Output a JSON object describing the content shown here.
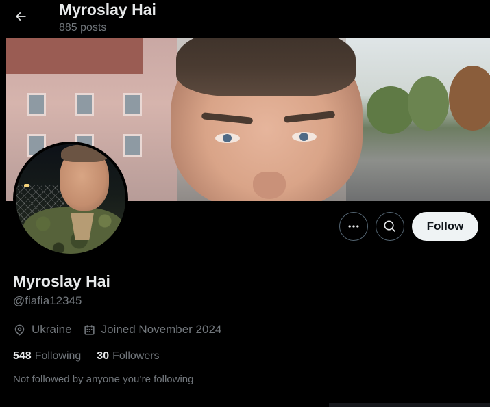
{
  "header": {
    "title": "Myroslay Hai",
    "post_count": "885 posts"
  },
  "profile": {
    "display_name": "Myroslay Hai",
    "handle": "@fiafia12345",
    "location": "Ukraine",
    "joined": "Joined November 2024",
    "following_count": "548",
    "following_label": "Following",
    "followers_count": "30",
    "followers_label": "Followers",
    "not_followed_text": "Not followed by anyone you’re following"
  },
  "actions": {
    "follow_label": "Follow",
    "more_icon": "more-horizontal-icon",
    "search_icon": "search-icon"
  },
  "icons": {
    "back": "arrow-left-icon",
    "location": "location-pin-icon",
    "calendar": "calendar-icon"
  },
  "colors": {
    "background": "#000000",
    "primary_text": "#e7e9ea",
    "secondary_text": "#71767b",
    "follow_button_bg": "#eff3f4",
    "follow_button_text": "#0f1419",
    "button_border": "#536471"
  }
}
